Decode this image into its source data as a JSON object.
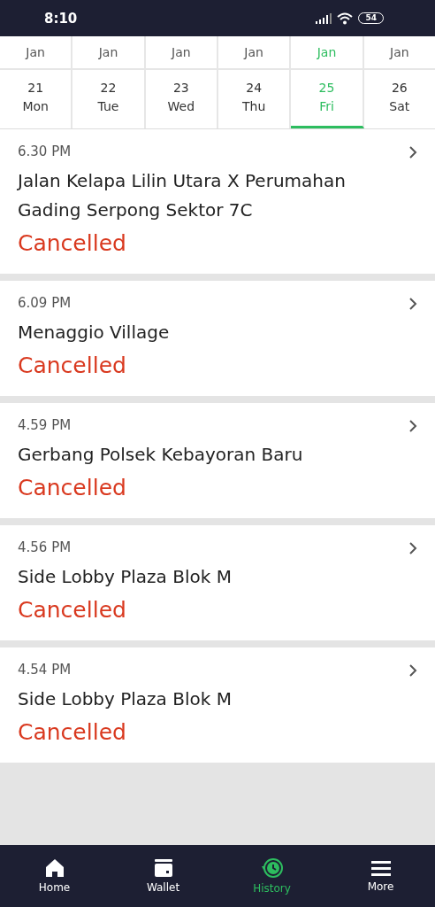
{
  "status_bar": {
    "time": "8:10",
    "battery": "54"
  },
  "dates": [
    {
      "month": "Jan",
      "day": "21",
      "weekday": "Mon",
      "selected": false
    },
    {
      "month": "Jan",
      "day": "22",
      "weekday": "Tue",
      "selected": false
    },
    {
      "month": "Jan",
      "day": "23",
      "weekday": "Wed",
      "selected": false
    },
    {
      "month": "Jan",
      "day": "24",
      "weekday": "Thu",
      "selected": false
    },
    {
      "month": "Jan",
      "day": "25",
      "weekday": "Fri",
      "selected": true
    },
    {
      "month": "Jan",
      "day": "26",
      "weekday": "Sat",
      "selected": false
    }
  ],
  "trips": [
    {
      "time": "6.30 PM",
      "address": "Jalan Kelapa Lilin Utara X Perumahan Gading Serpong Sektor 7C",
      "status": "Cancelled"
    },
    {
      "time": "6.09 PM",
      "address": "Menaggio Village",
      "status": "Cancelled"
    },
    {
      "time": "4.59 PM",
      "address": "Gerbang Polsek Kebayoran Baru",
      "status": "Cancelled"
    },
    {
      "time": "4.56 PM",
      "address": "Side Lobby Plaza Blok M",
      "status": "Cancelled"
    },
    {
      "time": "4.54 PM",
      "address": "Side Lobby Plaza Blok M",
      "status": "Cancelled"
    }
  ],
  "nav": [
    {
      "kind": "home",
      "label": "Home",
      "selected": false
    },
    {
      "kind": "wallet",
      "label": "Wallet",
      "selected": false
    },
    {
      "kind": "history",
      "label": "History",
      "selected": true
    },
    {
      "kind": "more",
      "label": "More",
      "selected": false
    }
  ]
}
